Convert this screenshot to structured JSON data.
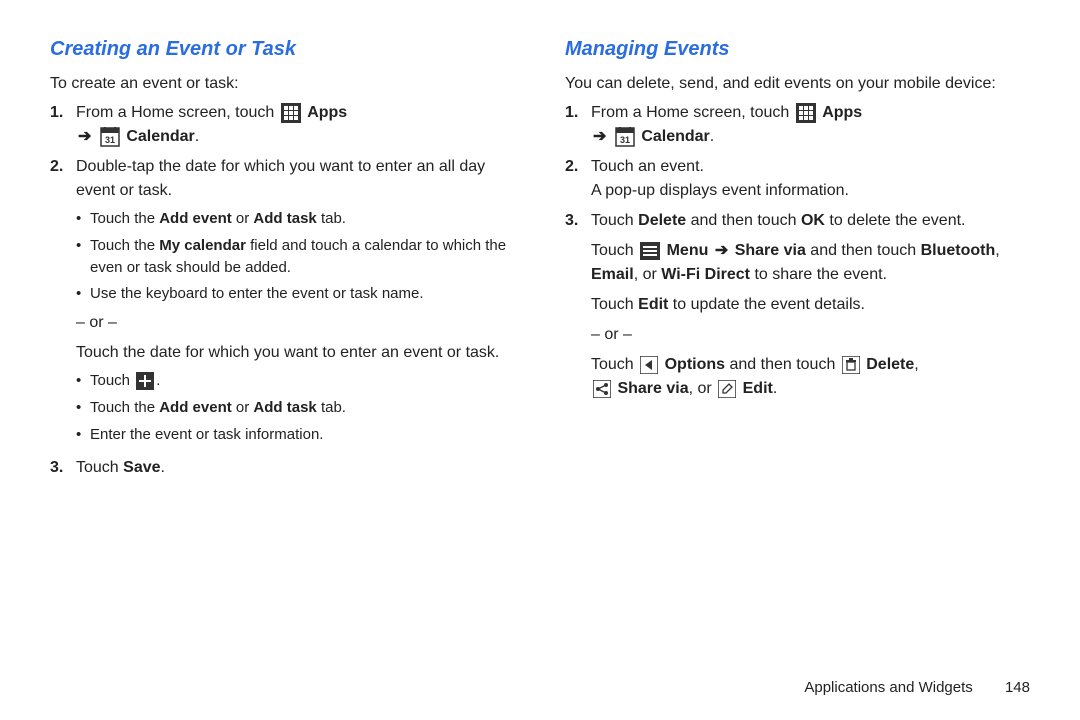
{
  "left": {
    "title": "Creating an Event or Task",
    "intro": "To create an event or task:",
    "step1_a": "From a Home screen, touch ",
    "apps": "Apps",
    "calendar": "Calendar",
    "step2": "Double-tap the date for which you want to enter an all day event or task.",
    "b2a_a": "Touch the ",
    "b2a_b": "Add event",
    "b2a_c": " or ",
    "b2a_d": "Add task",
    "b2a_e": " tab.",
    "b2b_a": "Touch the ",
    "b2b_b": "My calendar",
    "b2b_c": " field and touch a calendar to which the even or task should be added.",
    "b2c": "Use the keyboard to enter the event or task name.",
    "or": "– or –",
    "alt": "Touch the date for which you want to enter an event or task.",
    "ba_a": "Touch ",
    "ba_b": ".",
    "bb_a": "Touch the ",
    "bb_b": "Add event",
    "bb_c": " or ",
    "bb_d": "Add task",
    "bb_e": " tab.",
    "bc": "Enter the event or task information.",
    "step3_a": "Touch ",
    "step3_b": "Save",
    "step3_c": "."
  },
  "right": {
    "title": "Managing Events",
    "intro": "You can delete, send, and edit events on your mobile device:",
    "step1_a": "From a Home screen, touch ",
    "apps": "Apps",
    "calendar": "Calendar",
    "step2a": "Touch an event.",
    "step2b": "A pop-up displays event information.",
    "step3_a": "Touch ",
    "step3_b": "Delete",
    "step3_c": " and then touch ",
    "step3_d": "OK",
    "step3_e": " to delete the event.",
    "share_a": "Touch ",
    "share_menu": "Menu",
    "share_via": "Share via",
    "share_b": " and then touch ",
    "share_bt": "Bluetooth",
    "share_comma": ", ",
    "share_email": "Email",
    "share_or": ", or ",
    "share_wifi": "Wi-Fi Direct",
    "share_end": " to share the event.",
    "edit_a": "Touch ",
    "edit_b": "Edit",
    "edit_c": " to update the event details.",
    "or": "– or –",
    "opt_a": "Touch ",
    "opt_options": "Options",
    "opt_b": " and then touch ",
    "opt_delete": "Delete",
    "opt_comma": ", ",
    "opt_sharevia": "Share via",
    "opt_or": ", or ",
    "opt_edit": "Edit",
    "opt_end": "."
  },
  "footer": {
    "section": "Applications and Widgets",
    "page": "148"
  },
  "arrow": "➔"
}
